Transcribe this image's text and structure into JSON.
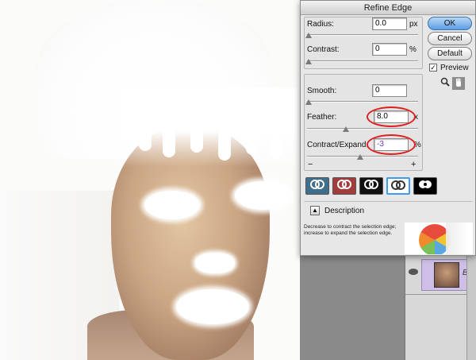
{
  "dialog": {
    "title": "Refine Edge",
    "radius": {
      "label": "Radius:",
      "value": "0.0",
      "unit": "px"
    },
    "contrast": {
      "label": "Contrast:",
      "value": "0",
      "unit": "%"
    },
    "smooth": {
      "label": "Smooth:",
      "value": "0"
    },
    "feather": {
      "label": "Feather:",
      "value": "8.0",
      "unit": "x"
    },
    "contract_expand": {
      "label": "Contract/Expand:",
      "value": "-3",
      "unit": "%",
      "minus": "−",
      "plus": "+"
    },
    "buttons": {
      "ok": "OK",
      "cancel": "Cancel",
      "default": "Default"
    },
    "preview": {
      "label": "Preview",
      "checked": true,
      "check_glyph": "✓"
    },
    "view_modes": [
      "standard",
      "quick-mask",
      "on-black",
      "on-white",
      "mask"
    ],
    "description": {
      "label": "Description",
      "text": "Decrease to contract the selection edge; increase to expand the selection edge."
    }
  },
  "annotation_color": "#e02020",
  "layers": {
    "name": "Bac"
  }
}
